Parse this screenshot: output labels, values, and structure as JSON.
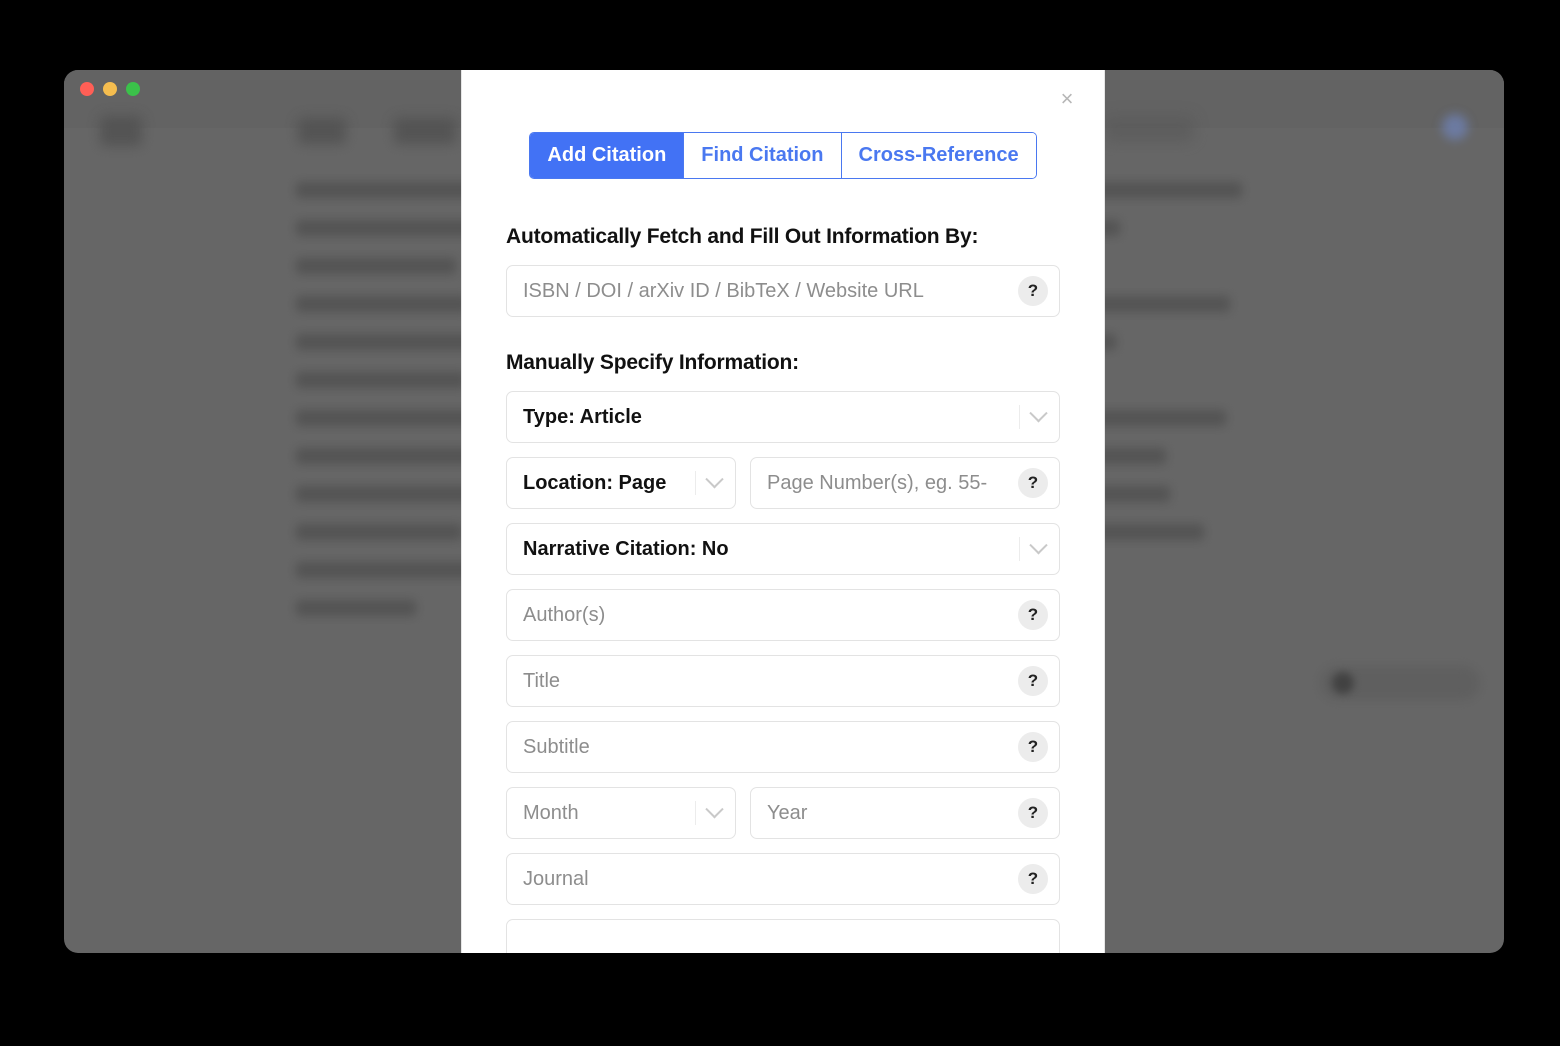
{
  "window": {
    "traffic_lights": [
      "close",
      "minimize",
      "maximize"
    ]
  },
  "modal": {
    "close_label": "×",
    "tabs": [
      {
        "label": "Add Citation",
        "active": true
      },
      {
        "label": "Find Citation",
        "active": false
      },
      {
        "label": "Cross-Reference",
        "active": false
      }
    ],
    "auto_section": {
      "title": "Automatically Fetch and Fill Out Information By:",
      "identifier_placeholder": "ISBN / DOI / arXiv ID / BibTeX / Website URL",
      "help_label": "?"
    },
    "manual_section": {
      "title": "Manually Specify Information:",
      "type_select": {
        "value": "Type: Article"
      },
      "location_select": {
        "value": "Location: Page"
      },
      "page_number": {
        "placeholder": "Page Number(s), eg. 55-",
        "help_label": "?"
      },
      "narrative_select": {
        "value": "Narrative Citation: No"
      },
      "authors": {
        "placeholder": "Author(s)",
        "help_label": "?"
      },
      "title_field": {
        "placeholder": "Title",
        "help_label": "?"
      },
      "subtitle": {
        "placeholder": "Subtitle",
        "help_label": "?"
      },
      "month_select": {
        "value": "Month"
      },
      "year": {
        "placeholder": "Year",
        "help_label": "?"
      },
      "journal": {
        "placeholder": "Journal",
        "help_label": "?"
      }
    }
  },
  "colors": {
    "accent": "#4272f5",
    "accent_border": "#4a78f0",
    "modal_bg": "#ffffff",
    "overlay": "#666666",
    "page_bg": "#000000",
    "placeholder": "#8d8d8d",
    "field_border": "#e3e3e3",
    "help_bg": "#ececec"
  }
}
